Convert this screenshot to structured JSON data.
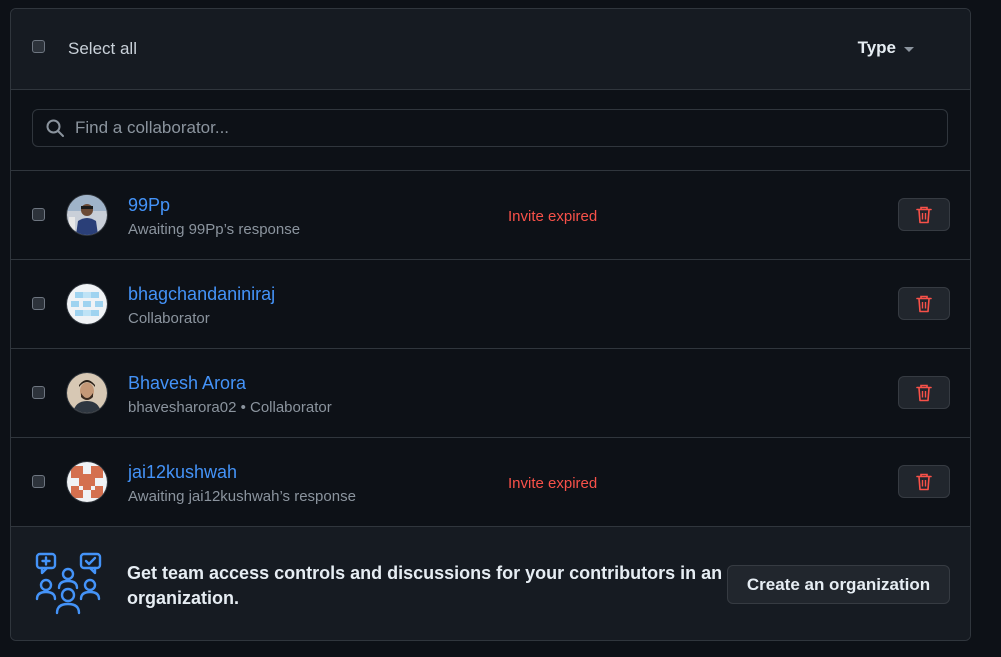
{
  "header": {
    "select_all_label": "Select all",
    "type_filter_label": "Type"
  },
  "search": {
    "placeholder": "Find a collaborator..."
  },
  "collaborators": [
    {
      "name": "99Pp",
      "subtitle": "Awaiting 99Pp’s response",
      "status": "Invite expired",
      "avatar_icon": "user-photo-avatar"
    },
    {
      "name": "bhagchandaniniraj",
      "subtitle": "Collaborator",
      "status": "",
      "avatar_icon": "identicon-blue-avatar"
    },
    {
      "name": "Bhavesh Arora",
      "subtitle": "bhavesharora02 • Collaborator",
      "status": "",
      "avatar_icon": "user-photo-avatar"
    },
    {
      "name": "jai12kushwah",
      "subtitle": "Awaiting jai12kushwah’s response",
      "status": "Invite expired",
      "avatar_icon": "identicon-orange-avatar"
    }
  ],
  "promo": {
    "text": "Get team access controls and discussions for your contributors in an organization.",
    "button_label": "Create an organization",
    "icon": "team-discussion-icon"
  },
  "colors": {
    "link": "#4493f8",
    "danger": "#f85149",
    "background": "#0d1117",
    "header_background": "#161b22",
    "border": "#30363d"
  }
}
